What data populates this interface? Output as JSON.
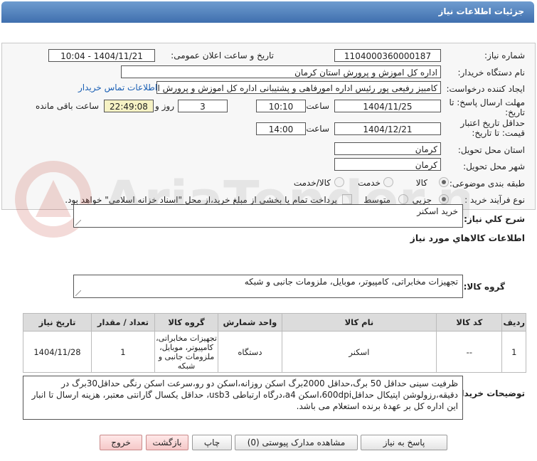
{
  "header": {
    "title": "جزئیات اطلاعات نیاز"
  },
  "form": {
    "need_number_label": "شماره نیاز:",
    "need_number": "1104000360000187",
    "announce_label": "تاریخ و ساعت اعلان عمومی:",
    "announce_value": "1404/11/21 - 10:04",
    "buyer_label": "نام دستگاه خریدار:",
    "buyer_value": "اداره کل اموزش و پرورش استان کرمان",
    "creator_label": "ایجاد کننده درخواست:",
    "creator_value": "کامبیز رفیعی پور رئیس اداره امورفاهی و پشتیبانی اداره کل اموزش و پرورش اس",
    "contact_link": "اطلاعات تماس خریدار",
    "reply_label_line1": "مهلت ارسال پاسخ: تا",
    "reply_label_line2": "تاریخ:",
    "reply_date": "1404/11/25",
    "time_label": "ساعت",
    "reply_time": "10:10",
    "days_value": "3",
    "days_label": "روز و",
    "remaining_time": "22:49:08",
    "remaining_label": "ساعت باقی مانده",
    "validity_label_line1": "حداقل تاریخ اعتبار",
    "validity_label_line2": "قیمت: تا تاریخ:",
    "validity_date": "1404/12/21",
    "validity_time": "14:00",
    "province_label": "استان محل تحویل:",
    "province_value": "کرمان",
    "city_label": "شهر محل تحویل:",
    "city_value": "کرمان",
    "category_label": "طبقه بندی موضوعی:",
    "category_options": [
      "کالا",
      "خدمت",
      "کالا/خدمت"
    ],
    "process_label": "نوع فرآیند خرید :",
    "process_options": [
      "جزیی",
      "متوسط"
    ],
    "payment_note": "پرداخت تمام یا بخشی از مبلغ خرید،از محل \"اسناد خزانه اسلامی\" خواهد بود."
  },
  "need": {
    "summary_label": "شرح کلي نياز:",
    "summary_value": "خرید اسکنر",
    "goods_info_title": "اطلاعات کالاهاي مورد نياز",
    "group_label": "گروه کالا:",
    "group_value": "تجهیزات مخابراتی، کامپیوتر، موبایل، ملزومات جانبی و شبکه"
  },
  "table": {
    "headers": [
      "ردیف",
      "کد کالا",
      "نام کالا",
      "واحد شمارش",
      "گروه کالا",
      "تعداد / مقدار",
      "تاریخ نیاز"
    ],
    "rows": [
      [
        "1",
        "--",
        "اسکنر",
        "دستگاه",
        "تجهیزات مخابراتی، کامپیوتر، موبایل، ملزومات جانبی و شبکه",
        "1",
        "1404/11/28"
      ]
    ]
  },
  "notes": {
    "label": "توضیحات خریدار:",
    "text": "ظرفیت سینی حداقل 50 برگ،حداقل 2000برگ اسکن روزانه،اسکن دو رو،سرعت اسکن رنگی حداقل30برگ در دقیقه،رزولوشن اپتیکال حداقل600dpi،اسکن a4،درگاه ارتباطی usb3، حداقل یکسال گارانتی معتبر، هزینه ارسال تا انبار این اداره کل بر عهدۀ برنده استعلام می باشد."
  },
  "buttons": {
    "reply": "پاسخ به نیاز",
    "attachments": "مشاهده مدارک پیوستی (0)",
    "print": "چاپ",
    "back": "بازگشت",
    "exit": "خروج"
  },
  "watermark": {
    "text": "AriaTender.neT"
  },
  "colors": {
    "header": "#4f7fbf",
    "link": "#1a5fb4",
    "remaining_bg": "#f6f2c4",
    "watermark": "#c0392b"
  }
}
